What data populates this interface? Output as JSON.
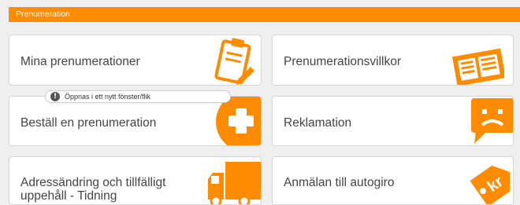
{
  "header": {
    "title": "Prenumeration"
  },
  "cards": [
    {
      "label": "Mina prenumerationer",
      "icon": "clipboard-icon"
    },
    {
      "label": "Prenumerationsvillkor",
      "icon": "newspaper-icon"
    },
    {
      "label": "Beställ en prenumeration",
      "icon": "plus-circle-icon"
    },
    {
      "label": "Reklamation",
      "icon": "sad-speech-bubble-icon"
    },
    {
      "label_line1": "Adressändring och tillfälligt",
      "label_line2": "uppehåll - Tidning",
      "icon": "truck-icon"
    },
    {
      "label": "Anmälan till autogiro",
      "icon": "price-tag-icon",
      "icon_text": "kr"
    }
  ],
  "tooltip": {
    "text": "Öppnas i ett nytt fönster/flik",
    "icon": "info-icon"
  },
  "colors": {
    "accent": "#ff8c00",
    "card_bg": "#ffffff",
    "page_bg": "#efefef",
    "text": "#444444"
  }
}
